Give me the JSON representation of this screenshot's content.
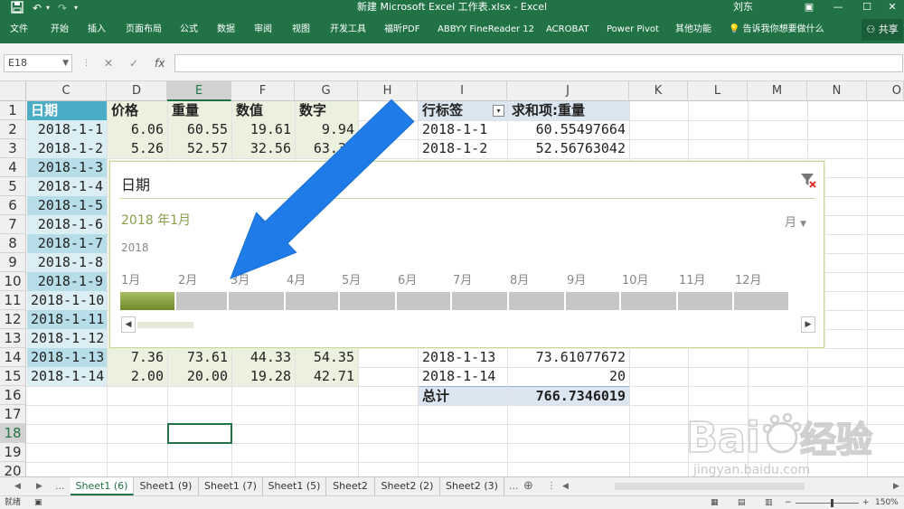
{
  "titlebar": {
    "title": "新建 Microsoft Excel 工作表.xlsx  -  Excel",
    "user": "刘东",
    "save_icon": "save-icon",
    "undo_icon": "undo-icon",
    "redo_icon": "redo-icon",
    "window_buttons": [
      "restore-icon",
      "minimize-icon",
      "maximize-icon",
      "close-icon"
    ]
  },
  "ribbon": {
    "tabs": [
      "文件",
      "开始",
      "插入",
      "页面布局",
      "公式",
      "数据",
      "审阅",
      "视图",
      "开发工具",
      "福昕PDF",
      "ABBYY FineReader 12",
      "ACROBAT",
      "Power Pivot",
      "其他功能"
    ],
    "tell_me": "告诉我你想要做什么",
    "share": "共享"
  },
  "formula_bar": {
    "name_box": "E18",
    "formula": ""
  },
  "columns": [
    "C",
    "D",
    "E",
    "F",
    "G",
    "H",
    "I",
    "J",
    "K",
    "L",
    "M",
    "N",
    "O"
  ],
  "rows": [
    "1",
    "2",
    "3",
    "4",
    "5",
    "6",
    "7",
    "8",
    "9",
    "10",
    "11",
    "12",
    "13",
    "14",
    "15",
    "16",
    "17",
    "18",
    "19",
    "20"
  ],
  "table": {
    "headers": [
      "日期",
      "价格",
      "重量",
      "数值",
      "数字"
    ],
    "dates": [
      "2018-1-1",
      "2018-1-2",
      "2018-1-3",
      "2018-1-4",
      "2018-1-5",
      "2018-1-6",
      "2018-1-7",
      "2018-1-8",
      "2018-1-9",
      "2018-1-10",
      "2018-1-11",
      "2018-1-12",
      "2018-1-13",
      "2018-1-14"
    ],
    "row2": [
      "6.06",
      "60.55",
      "19.61",
      "9.94"
    ],
    "row3": [
      "5.26",
      "52.57",
      "32.56",
      "63.33"
    ],
    "row14": [
      "7.36",
      "73.61",
      "44.33",
      "54.35"
    ],
    "row15": [
      "2.00",
      "20.00",
      "19.28",
      "42.71"
    ]
  },
  "pivot": {
    "header_row": "行标签",
    "header_sum": "求和项:重量",
    "rows": [
      {
        "label": "2018-1-1",
        "value": "60.55497664"
      },
      {
        "label": "2018-1-2",
        "value": "52.56763042"
      },
      {
        "label": "2018-1-13",
        "value": "73.61077672"
      },
      {
        "label": "2018-1-14",
        "value": "20"
      }
    ],
    "total_label": "总计",
    "total_value": "766.7346019"
  },
  "timeline": {
    "title": "日期",
    "selection": "2018 年1月",
    "level": "月",
    "year": "2018",
    "months": [
      "1月",
      "2月",
      "3月",
      "4月",
      "5月",
      "6月",
      "7月",
      "8月",
      "9月",
      "10月",
      "11月",
      "12月"
    ],
    "selected_month_index": 0
  },
  "sheets": {
    "nav_more": "...",
    "tabs": [
      "Sheet1 (6)",
      "Sheet1 (9)",
      "Sheet1 (7)",
      "Sheet1 (5)",
      "Sheet2",
      "Sheet2 (2)",
      "Sheet2 (3)"
    ],
    "active_index": 0,
    "more_right": "..."
  },
  "status": {
    "ready": "就绪",
    "zoom": "150%"
  },
  "colors": {
    "excel_green": "#217346",
    "arrow_blue": "#1e7be8",
    "timeline_selected": "#8a9e4a"
  }
}
